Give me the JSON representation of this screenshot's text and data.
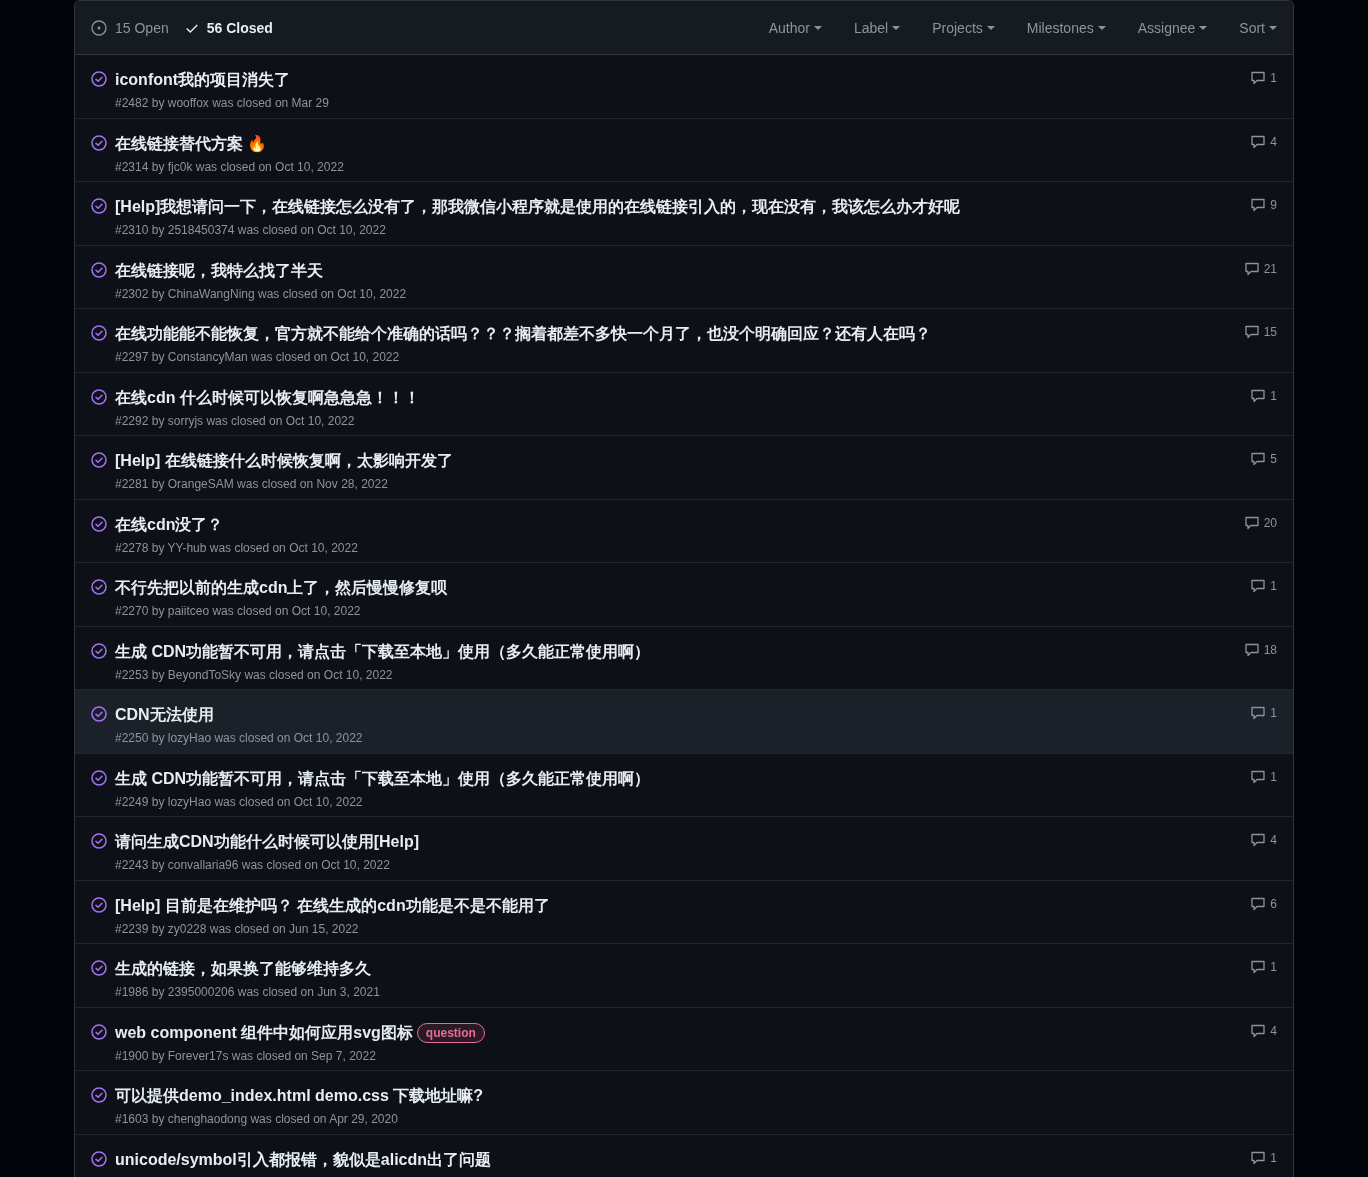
{
  "filters": {
    "open": {
      "label": "15 Open",
      "selected": false
    },
    "closed": {
      "label": "56 Closed",
      "selected": true
    }
  },
  "menus": [
    "Author",
    "Label",
    "Projects",
    "Milestones",
    "Assignee",
    "Sort"
  ],
  "issues": [
    {
      "title": "iconfont我的项目消失了",
      "meta": "#2482 by wooffox was closed on Mar 29",
      "comments": "1",
      "highlighted": false
    },
    {
      "title": "在线链接替代方案 🔥",
      "meta": "#2314 by fjc0k was closed on Oct 10, 2022",
      "comments": "4",
      "highlighted": false
    },
    {
      "title": "[Help]我想请问一下，在线链接怎么没有了，那我微信小程序就是使用的在线链接引入的，现在没有，我该怎么办才好呢",
      "meta": "#2310 by 2518450374 was closed on Oct 10, 2022",
      "comments": "9",
      "highlighted": false
    },
    {
      "title": "在线链接呢，我特么找了半天",
      "meta": "#2302 by ChinaWangNing was closed on Oct 10, 2022",
      "comments": "21",
      "highlighted": false
    },
    {
      "title": "在线功能能不能恢复，官方就不能给个准确的话吗？？？搁着都差不多快一个月了，也没个明确回应？还有人在吗？",
      "meta": "#2297 by ConstancyMan was closed on Oct 10, 2022",
      "comments": "15",
      "highlighted": false
    },
    {
      "title": "在线cdn 什么时候可以恢复啊急急急！！！",
      "meta": "#2292 by sorryjs was closed on Oct 10, 2022",
      "comments": "1",
      "highlighted": false
    },
    {
      "title": "[Help] 在线链接什么时候恢复啊，太影响开发了",
      "meta": "#2281 by OrangeSAM was closed on Nov 28, 2022",
      "comments": "5",
      "highlighted": false
    },
    {
      "title": "在线cdn没了？",
      "meta": "#2278 by YY-hub was closed on Oct 10, 2022",
      "comments": "20",
      "highlighted": false
    },
    {
      "title": "不行先把以前的生成cdn上了，然后慢慢修复呗",
      "meta": "#2270 by paiitceo was closed on Oct 10, 2022",
      "comments": "1",
      "highlighted": false
    },
    {
      "title": "生成 CDN功能暂不可用，请点击「下载至本地」使用（多久能正常使用啊）",
      "meta": "#2253 by BeyondToSky was closed on Oct 10, 2022",
      "comments": "18",
      "highlighted": false
    },
    {
      "title": "CDN无法使用",
      "meta": "#2250 by lozyHao was closed on Oct 10, 2022",
      "comments": "1",
      "highlighted": true
    },
    {
      "title": "生成 CDN功能暂不可用，请点击「下载至本地」使用（多久能正常使用啊）",
      "meta": "#2249 by lozyHao was closed on Oct 10, 2022",
      "comments": "1",
      "highlighted": false
    },
    {
      "title": "请问生成CDN功能什么时候可以使用[Help]",
      "meta": "#2243 by convallaria96 was closed on Oct 10, 2022",
      "comments": "4",
      "highlighted": false
    },
    {
      "title": "[Help] 目前是在维护吗？ 在线生成的cdn功能是不是不能用了",
      "meta": "#2239 by zy0228 was closed on Jun 15, 2022",
      "comments": "6",
      "highlighted": false
    },
    {
      "title": "生成的链接，如果换了能够维持多久",
      "meta": "#1986 by 2395000206 was closed on Jun 3, 2021",
      "comments": "1",
      "highlighted": false
    },
    {
      "title": "web component 组件中如何应用svg图标",
      "label": {
        "text": "question",
        "color": "#e26d9d"
      },
      "meta": "#1900 by Forever17s was closed on Sep 7, 2022",
      "comments": "4",
      "highlighted": false
    },
    {
      "title": "可以提供demo_index.html demo.css 下载地址嘛?",
      "meta": "#1603 by chenghaodong was closed on Apr 29, 2020",
      "highlighted": false
    },
    {
      "title": "unicode/symbol引入都报错，貌似是alicdn出了问题",
      "comments": "1",
      "highlighted": false
    }
  ]
}
